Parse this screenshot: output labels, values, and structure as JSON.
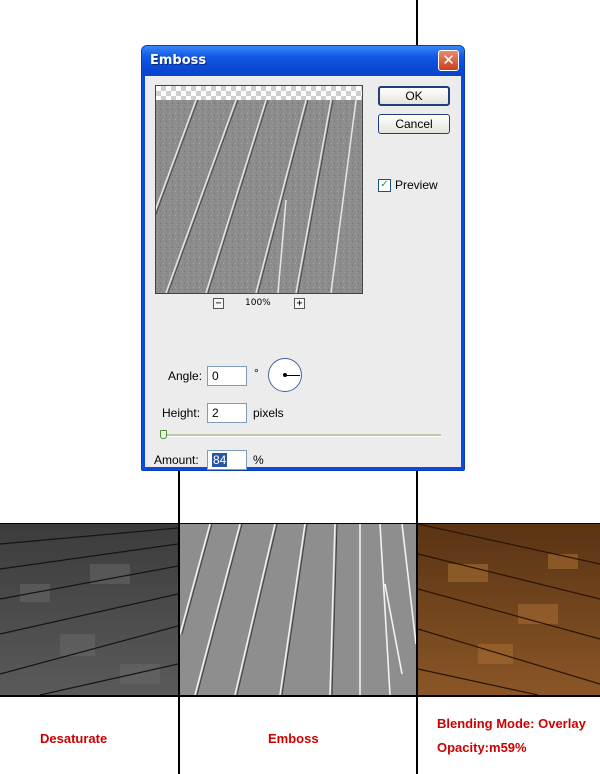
{
  "dialog": {
    "title": "Emboss",
    "close_label": "✕",
    "ok_label": "OK",
    "cancel_label": "Cancel",
    "preview_label": "Preview",
    "preview_checked": true,
    "zoom_out_label": "−",
    "zoom_in_label": "+",
    "zoom_value": "100%",
    "angle_label": "Angle:",
    "angle_value": "0",
    "angle_unit": "°",
    "height_label": "Height:",
    "height_value": "2",
    "height_unit": "pixels",
    "amount_label": "Amount:",
    "amount_value": "84",
    "amount_unit": "%",
    "height_slider_fraction": 0.0,
    "amount_slider_fraction": 0.45
  },
  "captions": {
    "desaturate": "Desaturate",
    "emboss": "Emboss",
    "overlay_line1": "Blending Mode: Overlay",
    "overlay_line2": "Opacity:m59%"
  },
  "colors": {
    "caption_red": "#cc0000",
    "dialog_blue": "#0b4ae0",
    "wood_brown": "#7a4a1e"
  }
}
